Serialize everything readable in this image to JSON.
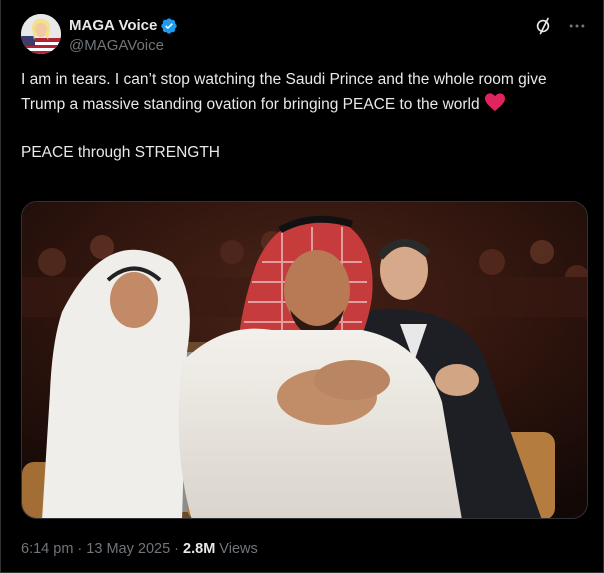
{
  "author": {
    "display_name": "MAGA Voice",
    "handle": "@MAGAVoice",
    "verified_icon": "verified-badge-icon",
    "badge_color": "#1d9bf0"
  },
  "actions": {
    "grok_icon": "grok-icon",
    "more_icon": "more-icon"
  },
  "post": {
    "text_line1": "I am in tears. I can’t stop watching the Saudi Prince and the whole room give Trump a massive standing ovation for bringing PEACE to the world ",
    "heart_icon": "red-heart-emoji",
    "text_line2": "PEACE through STRENGTH"
  },
  "media": {
    "type": "video-still"
  },
  "meta": {
    "time": "6:14 pm",
    "separator1": " · ",
    "date": "13 May 2025",
    "separator2": " · ",
    "views_count": "2.8M",
    "views_label": " Views"
  },
  "colors": {
    "background": "#000000",
    "text": "#e7e9ea",
    "secondary_text": "#71767b",
    "border": "#2f3336",
    "heart": "#e0245e"
  }
}
